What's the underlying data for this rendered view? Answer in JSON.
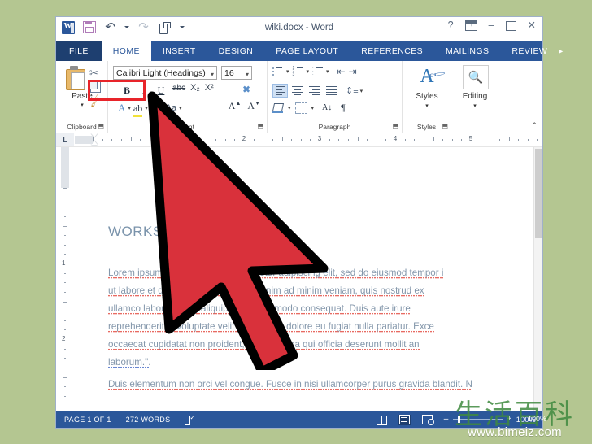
{
  "desktop": {
    "background_color": "#b4c691"
  },
  "window": {
    "title": "wiki.docx - Word",
    "quick_access": [
      {
        "name": "word-icon",
        "label": "W"
      },
      {
        "name": "save-icon",
        "label": "Save"
      },
      {
        "name": "undo-icon",
        "label": "Undo"
      },
      {
        "name": "redo-icon",
        "label": "Redo"
      },
      {
        "name": "touch-mode-icon",
        "label": "Touch/Mouse Mode"
      },
      {
        "name": "customize-qat-icon",
        "label": "Customize Quick Access Toolbar"
      }
    ],
    "controls": {
      "help": "?",
      "ribbon_display": "Ribbon Display Options",
      "minimize": "–",
      "maximize": "□",
      "close": "✕"
    }
  },
  "tabs": [
    {
      "label": "FILE",
      "active": false,
      "file": true
    },
    {
      "label": "HOME",
      "active": true
    },
    {
      "label": "INSERT",
      "active": false
    },
    {
      "label": "DESIGN",
      "active": false
    },
    {
      "label": "PAGE LAYOUT",
      "active": false
    },
    {
      "label": "REFERENCES",
      "active": false
    },
    {
      "label": "MAILINGS",
      "active": false
    },
    {
      "label": "REVIEW",
      "active": false
    }
  ],
  "tabs_overflow": "▸",
  "ribbon": {
    "clipboard": {
      "group_label": "Clipboard",
      "paste_label": "Paste",
      "paste_arrow": "▾",
      "cut_label": "Cut",
      "copy_label": "Copy",
      "format_painter_label": "Format Painter",
      "dialog_launcher": "⬒"
    },
    "font": {
      "group_label": "Font",
      "font_name": "Calibri Light (Headings)",
      "font_size": "16",
      "dropdown_arrow": "▾",
      "bold": "B",
      "italic": "I",
      "underline": "U",
      "strikethrough": "abc",
      "subscript": "X₂",
      "superscript": "X²",
      "clear_formatting": "Clear All Formatting",
      "text_effects": "A",
      "highlight": "ab",
      "font_color": "A",
      "change_case": "Aa",
      "grow_font": "A",
      "shrink_font": "A",
      "dialog_launcher": "⬒"
    },
    "paragraph": {
      "group_label": "Paragraph",
      "bullets": "Bullets",
      "numbering": "Numbering",
      "multilevel": "Multilevel List",
      "decrease_indent": "Decrease Indent",
      "increase_indent": "Increase Indent",
      "align_left": "Align Left",
      "align_center": "Center",
      "align_right": "Align Right",
      "justify": "Justify",
      "line_spacing": "Line and Paragraph Spacing",
      "shading": "Shading",
      "borders": "Borders",
      "sort": "Sort",
      "show_marks": "¶",
      "dialog_launcher": "⬒"
    },
    "styles": {
      "group_label": "Styles",
      "button_label": "Styles",
      "glyph": "A",
      "arrow": "▾",
      "dialog_launcher": "⬒"
    },
    "editing": {
      "group_label": "Editing",
      "button_label": "Editing",
      "glyph": "\u0001",
      "arrow": "▾"
    },
    "collapse_ribbon": "⌃"
  },
  "highlight_box": {
    "target": "bold-italic-underline-buttons",
    "color": "#e8242a"
  },
  "ruler": {
    "tab_stop_marker": "L",
    "horizontal_numbers": [
      "2",
      "3",
      "4",
      "5"
    ],
    "vertical_numbers": [
      "1",
      "2"
    ]
  },
  "document": {
    "heading": "WORKS CITED",
    "paragraphs": [
      "Lorem ipsum dolor sit amet, consectetur adipiscing elit, sed do eiusmod tempor i",
      "ut labore et dolore magna aliqua. Ut enim ad minim veniam, quis nostrud ex",
      "ullamco laboris nisi ut aliquip ex ea commodo consequat. Duis aute irure",
      "reprehenderit in voluptate velit esse cillum dolore eu fugiat nulla pariatur. Exce",
      "occaecat cupidatat non proident, sunt in culpa qui officia deserunt mollit an",
      "laborum.\"."
    ],
    "last_paragraph": "Duis elementum non orci vel congue. Fusce in nisi ullamcorper purus gravida blandit. N",
    "text_color": "#8497ab",
    "heading_color": "#7a93ab"
  },
  "status_bar": {
    "page": "PAGE 1 OF 1",
    "words": "272 WORDS",
    "proofing_icon": "proofing-errors-icon",
    "views": [
      {
        "name": "read-mode",
        "label": "Read Mode",
        "selected": false
      },
      {
        "name": "print-layout",
        "label": "Print Layout",
        "selected": true
      },
      {
        "name": "web-layout",
        "label": "Web Layout",
        "selected": false
      }
    ],
    "zoom_minus": "–",
    "zoom_plus": "+",
    "zoom_level": "100%"
  },
  "cursor": {
    "type": "arrow-pointer",
    "fill": "#d9313b",
    "stroke": "#000000"
  },
  "watermark": {
    "cjk": "生活百科",
    "url": "www.bimeiz.com"
  }
}
